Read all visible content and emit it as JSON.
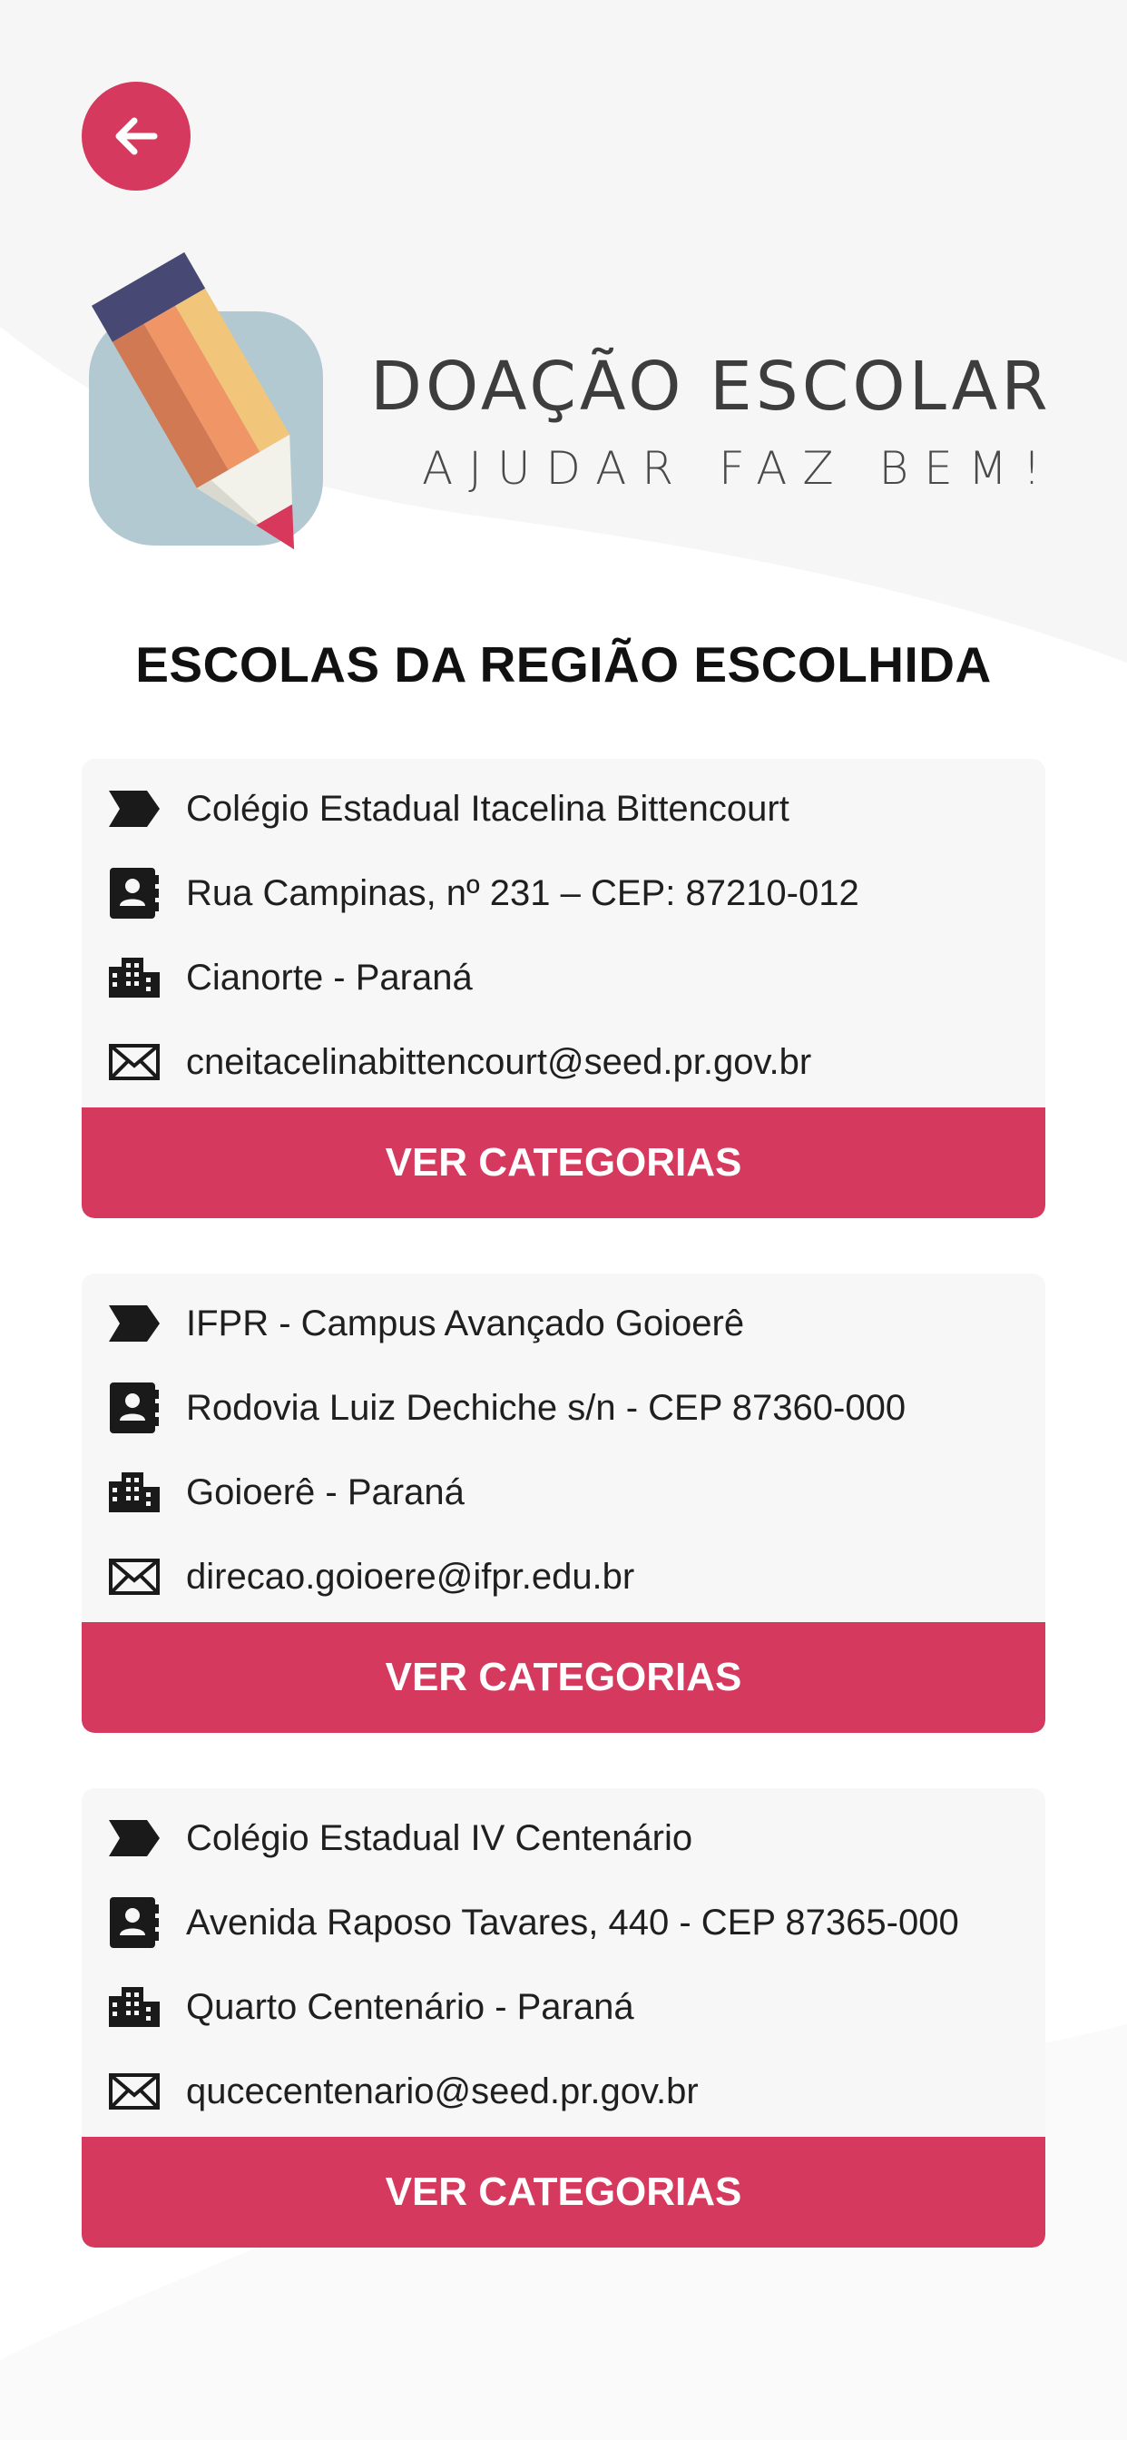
{
  "colors": {
    "accent": "#d5395e",
    "card_bg": "#f7f7f7",
    "text": "#1f1f1f"
  },
  "logo": {
    "title": "DOAÇÃO ESCOLAR",
    "subtitle": "AJUDAR FAZ BEM!"
  },
  "page_title": "ESCOLAS DA REGIÃO ESCOLHIDA",
  "back_icon": "arrow-left-icon",
  "schools": [
    {
      "name": "Colégio Estadual Itacelina Bittencourt",
      "address": "Rua Campinas, nº 231 – CEP: 87210-012",
      "city": "Cianorte - Paraná",
      "email": "cneitacelinabittencourt@seed.pr.gov.br",
      "button": "VER CATEGORIAS"
    },
    {
      "name": "IFPR - Campus Avançado Goioerê",
      "address": "Rodovia Luiz Dechiche s/n - CEP 87360-000",
      "city": "Goioerê - Paraná",
      "email": "direcao.goioere@ifpr.edu.br",
      "button": "VER CATEGORIAS"
    },
    {
      "name": "Colégio Estadual IV Centenário",
      "address": "Avenida Raposo Tavares, 440 - CEP 87365-000",
      "city": "Quarto Centenário - Paraná",
      "email": "qucecentenario@seed.pr.gov.br",
      "button": "VER CATEGORIAS"
    }
  ]
}
